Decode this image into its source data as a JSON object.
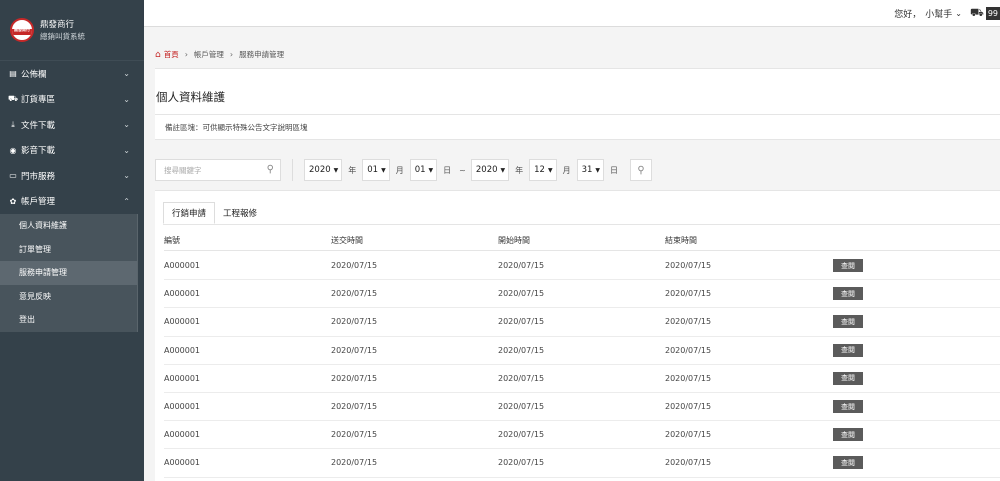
{
  "brand": {
    "name": "鼎發商行",
    "subtitle": "總銷叫貨系統",
    "logo_text": "鼎發商行"
  },
  "sidebar": {
    "items": [
      {
        "label": "公佈欄",
        "icon": "bulletin-icon",
        "glyph": "▤",
        "expanded": false
      },
      {
        "label": "訂貨專區",
        "icon": "cart-icon",
        "glyph": "⛟",
        "expanded": false
      },
      {
        "label": "文件下載",
        "icon": "download-icon",
        "glyph": "⤓",
        "expanded": false
      },
      {
        "label": "影音下載",
        "icon": "media-icon",
        "glyph": "◉",
        "expanded": false
      },
      {
        "label": "門市服務",
        "icon": "store-icon",
        "glyph": "▭",
        "expanded": false
      },
      {
        "label": "帳戶管理",
        "icon": "gear-icon",
        "glyph": "✿",
        "expanded": true
      }
    ],
    "subitems": [
      {
        "label": "個人資料維護",
        "active": false
      },
      {
        "label": "訂單管理",
        "active": false
      },
      {
        "label": "服務申請管理",
        "active": true
      },
      {
        "label": "意見反映",
        "active": false
      },
      {
        "label": "登出",
        "active": false
      }
    ]
  },
  "topbar": {
    "greeting": "您好，",
    "username": "小幫手",
    "cart_count": "99"
  },
  "breadcrumb": {
    "home": "首頁",
    "level1": "帳戶管理",
    "level2": "服務申請管理"
  },
  "page_title": "個人資料維護",
  "note": "備註區塊：可供顯示特殊公告文字說明區塊",
  "filter": {
    "search_placeholder": "搜尋關鍵字",
    "start_year": "2020",
    "start_month": "01",
    "start_day": "01",
    "end_year": "2020",
    "end_month": "12",
    "end_day": "31",
    "unit_year": "年",
    "unit_month": "月",
    "unit_day": "日",
    "tilde": "~"
  },
  "tabs": [
    {
      "label": "行銷申請",
      "active": true
    },
    {
      "label": "工程報修",
      "active": false
    }
  ],
  "table": {
    "headers": [
      "編號",
      "送交時間",
      "開始時間",
      "結束時間"
    ],
    "view_label": "查閱",
    "rows": [
      {
        "id": "A000001",
        "submitted": "2020/07/15",
        "start": "2020/07/15",
        "end": "2020/07/15"
      },
      {
        "id": "A000001",
        "submitted": "2020/07/15",
        "start": "2020/07/15",
        "end": "2020/07/15"
      },
      {
        "id": "A000001",
        "submitted": "2020/07/15",
        "start": "2020/07/15",
        "end": "2020/07/15"
      },
      {
        "id": "A000001",
        "submitted": "2020/07/15",
        "start": "2020/07/15",
        "end": "2020/07/15"
      },
      {
        "id": "A000001",
        "submitted": "2020/07/15",
        "start": "2020/07/15",
        "end": "2020/07/15"
      },
      {
        "id": "A000001",
        "submitted": "2020/07/15",
        "start": "2020/07/15",
        "end": "2020/07/15"
      },
      {
        "id": "A000001",
        "submitted": "2020/07/15",
        "start": "2020/07/15",
        "end": "2020/07/15"
      },
      {
        "id": "A000001",
        "submitted": "2020/07/15",
        "start": "2020/07/15",
        "end": "2020/07/15"
      }
    ]
  },
  "colors": {
    "sidebar_bg": "#34414a",
    "accent_red": "#c62828",
    "view_button": "#5b5b5b"
  }
}
